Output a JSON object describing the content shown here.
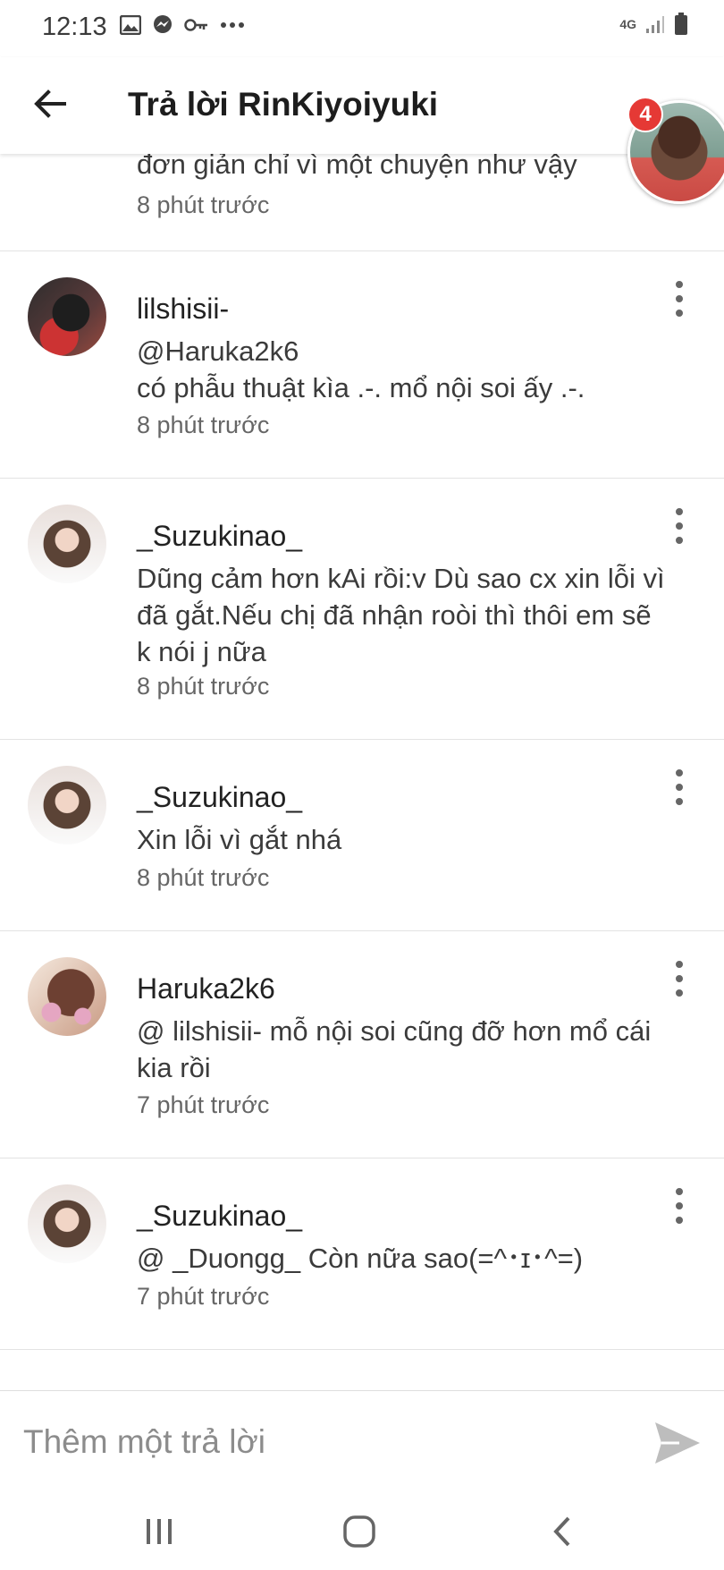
{
  "status_bar": {
    "time": "12:13",
    "network": "4G",
    "icons": [
      "image-icon",
      "messenger-icon",
      "key-icon",
      "more-dots-icon",
      "signal-icon",
      "battery-icon"
    ]
  },
  "app_bar": {
    "title": "Trả lời RinKiyoiyuki",
    "chat_bubble_badge": "4"
  },
  "comments": {
    "partial": {
      "text": "đơn giản chỉ vì một chuyện như vậy",
      "time": "8 phút trước"
    },
    "items": [
      {
        "username": "lilshisii-",
        "lines": [
          "@Haruka2k6",
          "có phẫu thuật kìa .-. mổ nội soi ấy .-."
        ],
        "time": "8 phút trước"
      },
      {
        "username": "_Suzukinao_",
        "lines": [
          "Dũng cảm hơn kAi rồi:v Dù sao cx xin lỗi vì",
          "đã gắt.Nếu chị đã nhận roòi thì thôi em sẽ",
          "k nói j nữa"
        ],
        "time": "8 phút trước"
      },
      {
        "username": "_Suzukinao_",
        "lines": [
          "Xin lỗi vì gắt nhá"
        ],
        "time": "8 phút trước"
      },
      {
        "username": "Haruka2k6",
        "lines": [
          "@ lilshisii-  mỗ nội soi cũng đỡ hơn mổ cái",
          "kia rồi"
        ],
        "time": "7 phút trước"
      },
      {
        "username": "_Suzukinao_",
        "lines": [
          "@ _Duongg_  Còn nữa sao(=^･ɪ･^=)"
        ],
        "time": "7 phút trước"
      }
    ]
  },
  "reply_bar": {
    "placeholder": "Thêm một trả lời"
  },
  "colors": {
    "badge": "#e53935",
    "text_primary": "#222222",
    "text_secondary": "#666666",
    "divider": "#e3e3e3"
  }
}
